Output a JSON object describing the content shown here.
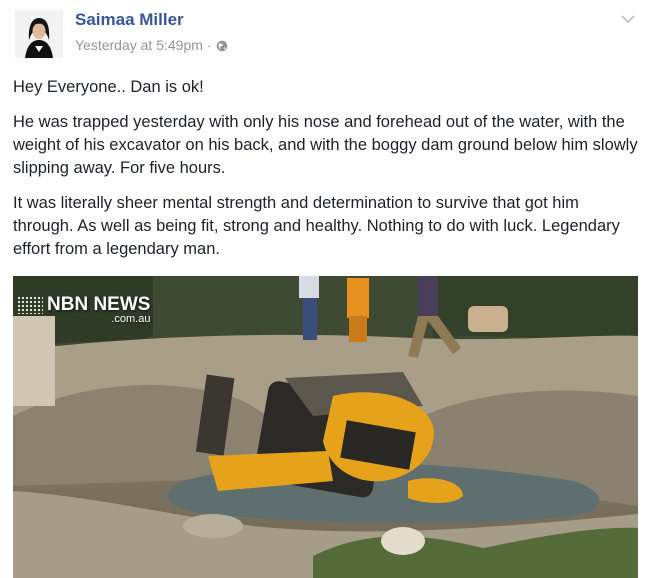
{
  "post": {
    "author": "Saimaa Miller",
    "timestamp": "Yesterday at 5:49pm",
    "separator": "·",
    "privacy_icon": "globe-icon",
    "menu_icon": "chevron-down-icon",
    "paragraphs": [
      "Hey Everyone.. Dan is ok!",
      "He was trapped yesterday with only his nose and forehead out of the water, with the weight of his excavator on his back, and with the boggy dam ground below him slowly slipping away. For five hours.",
      "It was literally sheer mental strength and determination to survive that got him through. As well as being fit, strong and healthy. Nothing to do with luck. Legendary effort from a legendary man."
    ],
    "photo": {
      "watermark_main": "NBN NEWS",
      "watermark_sub": ".com.au"
    }
  },
  "colors": {
    "author_link": "#365899",
    "meta_text": "#90949c",
    "body_text": "#1d2129",
    "excavator_yellow": "#e6a21a"
  }
}
